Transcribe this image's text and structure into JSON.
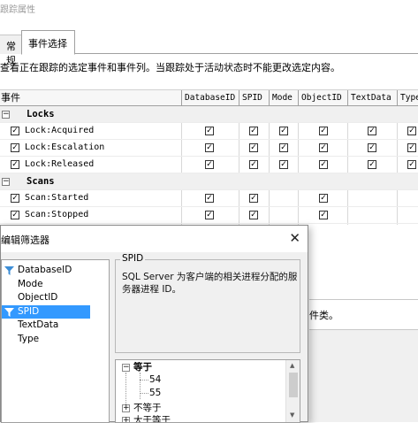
{
  "window": {
    "title": "跟踪属性"
  },
  "tabs": [
    {
      "label": "常规"
    },
    {
      "label": "事件选择"
    }
  ],
  "description": "查看正在跟踪的选定事件和事件列。当跟踪处于活动状态时不能更改选定内容。",
  "grid": {
    "columns": [
      "事件",
      "DatabaseID",
      "SPID",
      "Mode",
      "ObjectID",
      "TextData",
      "Type"
    ],
    "rows": [
      {
        "kind": "category",
        "label": "Locks",
        "expander": "−"
      },
      {
        "kind": "event",
        "label": "Lock:Acquired",
        "checks": [
          true,
          true,
          true,
          true,
          true,
          true
        ]
      },
      {
        "kind": "event",
        "label": "Lock:Escalation",
        "checks": [
          true,
          true,
          true,
          true,
          true,
          true
        ]
      },
      {
        "kind": "event",
        "label": "Lock:Released",
        "checks": [
          true,
          true,
          true,
          true,
          true,
          true
        ]
      },
      {
        "kind": "category",
        "label": "Scans",
        "expander": "−"
      },
      {
        "kind": "event",
        "label": "Scan:Started",
        "checks": [
          true,
          true,
          false,
          true,
          false,
          false
        ]
      },
      {
        "kind": "event",
        "label": "Scan:Stopped",
        "checks": [
          true,
          true,
          false,
          true,
          false,
          false
        ]
      }
    ],
    "check_glyph": "✓"
  },
  "lower_partial_text": "件类。",
  "dialog": {
    "title": "编辑筛选器",
    "close_glyph": "✕",
    "columns": [
      "DatabaseID",
      "Mode",
      "ObjectID",
      "SPID",
      "TextData",
      "Type"
    ],
    "filtered_columns": [
      "DatabaseID",
      "SPID"
    ],
    "selected_column": "SPID",
    "info_legend": "SPID",
    "info_text": "SQL Server 为客户端的相关进程分配的服务器进程 ID。",
    "tree": {
      "equals_label": "等于",
      "equals_values": [
        "54",
        "55"
      ],
      "not_equals_label": "不等于",
      "greater_equal_label": "大于等于"
    },
    "scroll": {
      "up": "▲",
      "down": "▼"
    }
  },
  "colors": {
    "selection": "#3399ff",
    "funnel": "#3c8dd6"
  }
}
